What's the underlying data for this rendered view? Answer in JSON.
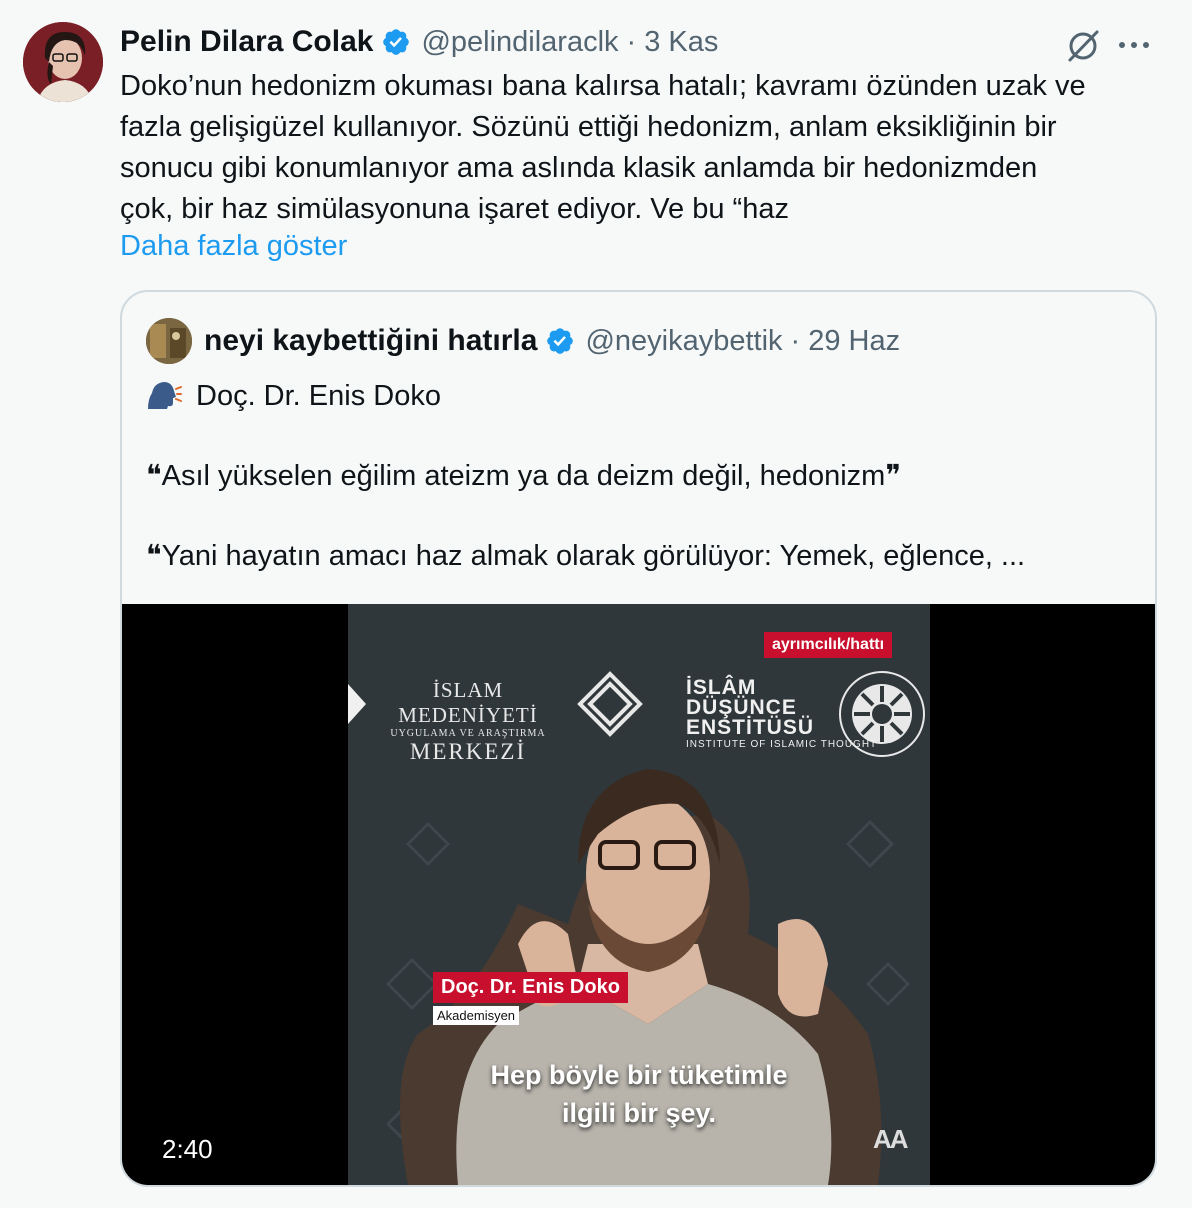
{
  "tweet": {
    "author_name": "Pelin Dilara Colak",
    "handle": "@pelindilaraclk",
    "separator": "·",
    "time": "3 Kas",
    "text": "Doko’nun hedonizm okuması bana kalırsa hatalı; kavramı özünden uzak ve\nfazla gelişigüzel kullanıyor. Sözünü ettiği hedonizm, anlam eksikliğinin bir\nsonucu gibi konumlanıyor ama aslında klasik anlamda bir hedonizmden\nçok, bir haz simülasyonuna işaret ediyor. Ve bu “haz",
    "show_more": "Daha fazla göster",
    "icons": {
      "grok": "grok-icon",
      "more": "more-options-icon",
      "verified": "verified-badge-icon"
    },
    "accent_color": "#1d9bf0"
  },
  "quoted": {
    "author_name": "neyi kaybettiğini hatırla",
    "handle": "@neyikaybettik",
    "separator": "·",
    "time": "29 Haz",
    "line1": "Doç. Dr. Enis Doko",
    "quote1": "❝Asıl yükselen eğilim ateizm ya da deizm değil, hedonizm❞",
    "quote2": "❝Yani hayatın amacı haz almak olarak görülüyor: Yemek, eğlence, ...",
    "speaking_icon": "speaking-head-icon",
    "video": {
      "duration": "2:40",
      "channel_badge": "ayrımcılık/hattı",
      "logo1_line1": "İSLAM MEDENİYETİ",
      "logo1_line2": "UYGULAMA VE ARAŞTIRMA",
      "logo1_line3": "MERKEZİ",
      "logo2_line1": "İSLÂM",
      "logo2_line2": "DÜŞÜNCE",
      "logo2_line3": "ENSTİTÜSÜ",
      "logo2_sub": "INSTITUTE OF ISLAMIC THOUGHT",
      "speaker_name": "Doç. Dr. Enis Doko",
      "speaker_role": "Akademisyen",
      "subtitle_line1": "Hep böyle bir tüketimle",
      "subtitle_line2": "ilgili bir şey.",
      "watermark": "AA"
    }
  }
}
